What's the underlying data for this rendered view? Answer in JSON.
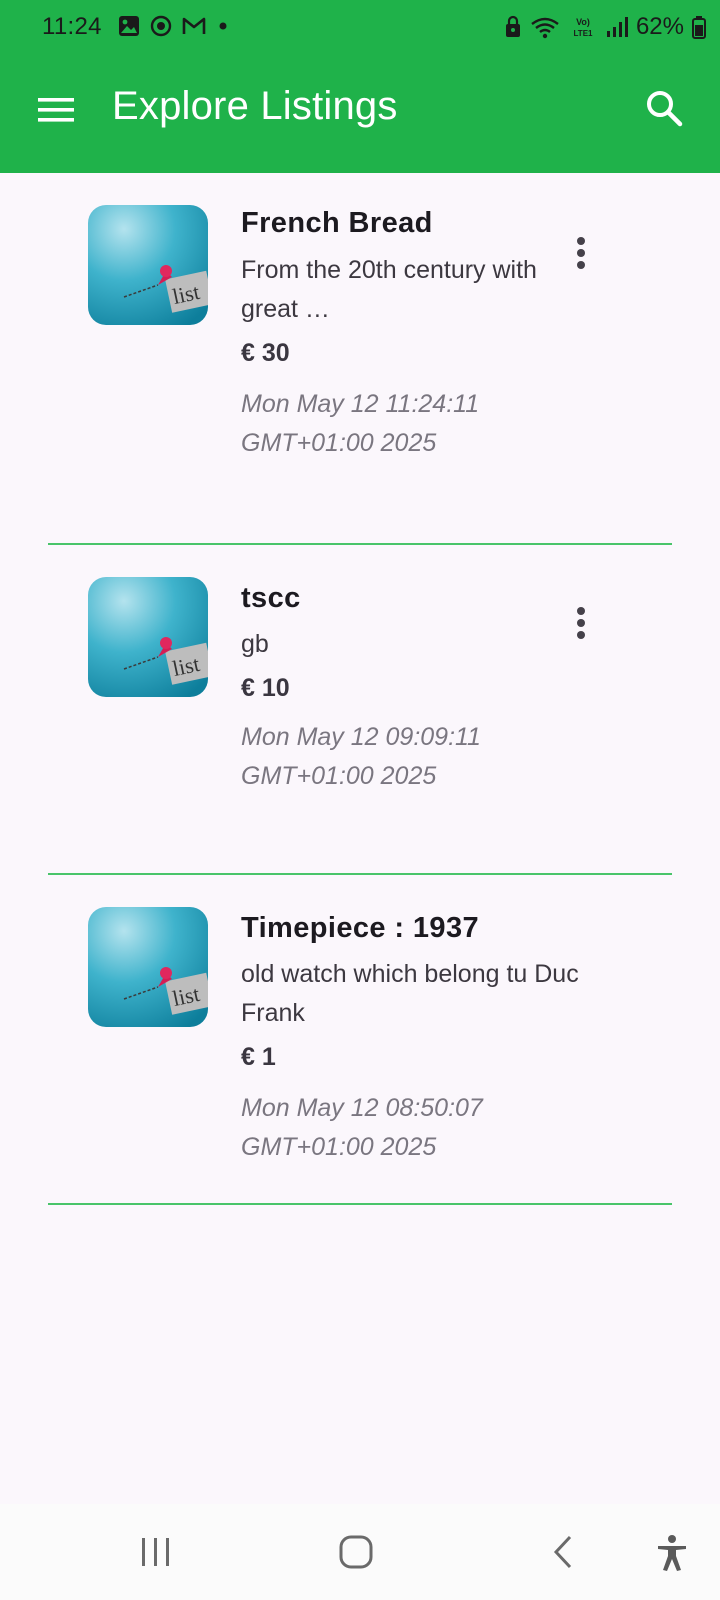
{
  "status_bar": {
    "time": "11:24",
    "battery": "62%",
    "left_icons": [
      "gallery-icon",
      "record-icon",
      "gmail-icon",
      "dot-icon"
    ],
    "right_icons": [
      "lock-icon",
      "wifi-icon",
      "volte-icon",
      "signal-icon",
      "battery-icon"
    ]
  },
  "app_bar": {
    "title": "Explore Listings",
    "color": "#1fb24a"
  },
  "listings": [
    {
      "title": "French Bread",
      "description": "From the 20th century with great …",
      "price": "€ 30",
      "date": "Mon May 12 11:24:11 GMT+01:00 2025",
      "has_menu": true
    },
    {
      "title": "tscc",
      "description": "gb",
      "price": "€ 10",
      "date": "Mon May 12 09:09:11 GMT+01:00 2025",
      "has_menu": true
    },
    {
      "title": "Timepiece : 1937",
      "description": "old watch which belong tu Duc Frank",
      "price": "€ 1",
      "date": "Mon May 12 08:50:07 GMT+01:00 2025",
      "has_menu": false
    }
  ],
  "nav_bar": {
    "buttons": [
      "recent-apps-icon",
      "home-icon",
      "back-icon",
      "accessibility-icon"
    ]
  }
}
